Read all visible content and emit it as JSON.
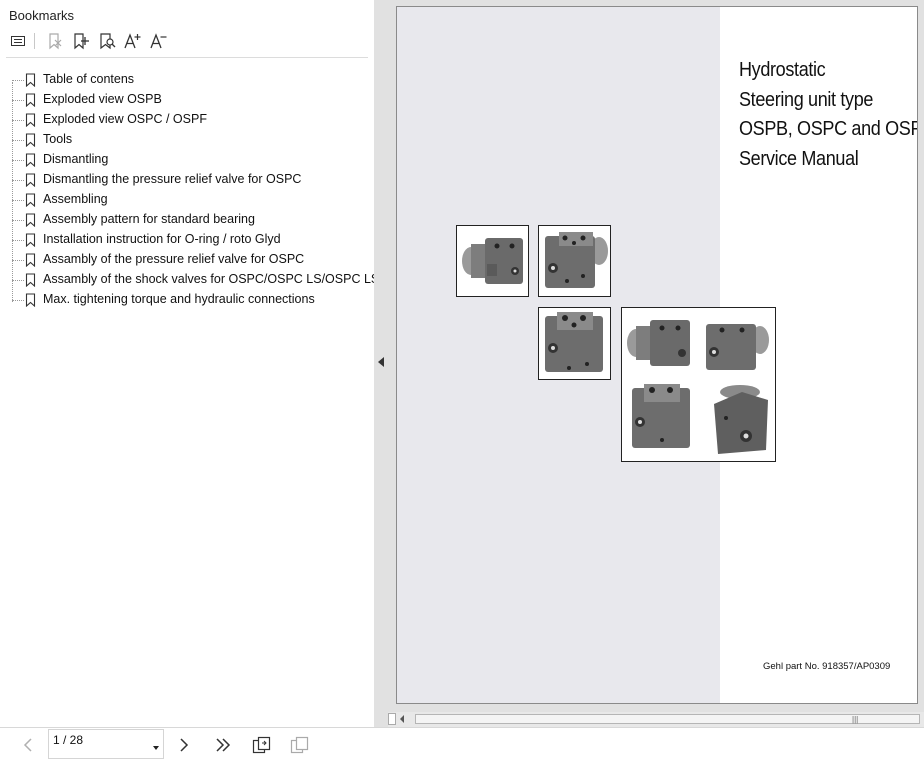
{
  "bookmarks_panel": {
    "title": "Bookmarks",
    "toolbar": [
      {
        "name": "expand-options-icon"
      },
      {
        "name": "delete-bookmark-icon"
      },
      {
        "name": "add-bookmark-icon"
      },
      {
        "name": "bookmark-search-icon"
      },
      {
        "name": "increase-font-icon"
      },
      {
        "name": "decrease-font-icon"
      }
    ],
    "items": [
      {
        "label": "Table of contens"
      },
      {
        "label": "Exploded view OSPB"
      },
      {
        "label": "Exploded view OSPC / OSPF"
      },
      {
        "label": "Tools"
      },
      {
        "label": "Dismantling"
      },
      {
        "label": "Dismantling the pressure relief valve for OSPC"
      },
      {
        "label": "Assembling"
      },
      {
        "label": "Assembly pattern for standard bearing"
      },
      {
        "label": "Installation instruction for O-ring / roto Glyd"
      },
      {
        "label": "Assambly of the pressure relief valve for OSPC"
      },
      {
        "label": "Assambly of the shock valves for OSPC/OSPC LS/OSPC LSR"
      },
      {
        "label": "Max. tightening torque and hydraulic connections"
      }
    ]
  },
  "document": {
    "title_lines": [
      "Hydrostatic",
      "Steering unit type",
      "OSPB, OSPC and OSPF",
      "Service Manual"
    ],
    "part_number": "Gehl part No. 918357/AP0309",
    "page_left_color": "#e8e8ed"
  },
  "navigation": {
    "page_indicator": "1 / 28",
    "buttons": [
      "previous-page",
      "next-page",
      "last-page",
      "rotate-page",
      "copy-page"
    ]
  },
  "colors": {
    "panel_bg": "#ffffff",
    "splitter_bg": "#e1e1e1",
    "viewer_bg": "#e1e1e1"
  }
}
